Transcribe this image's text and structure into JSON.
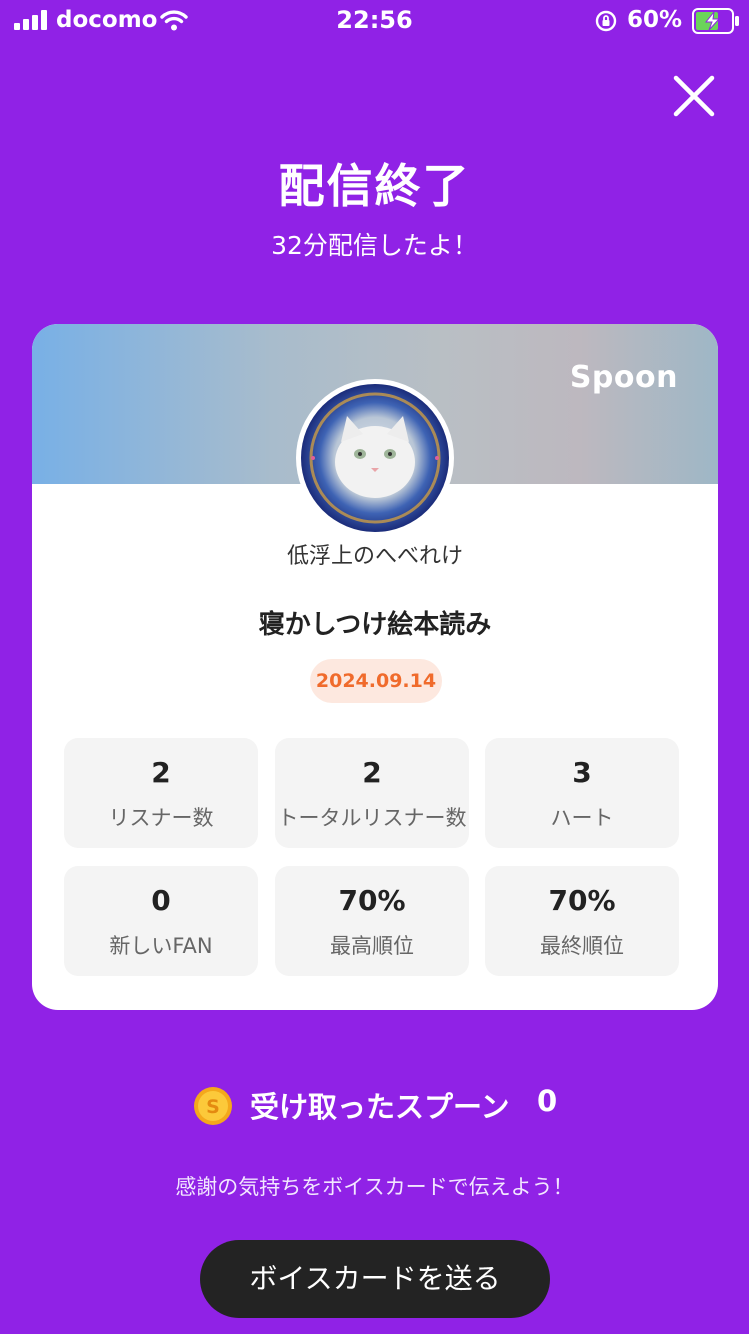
{
  "status_bar": {
    "carrier": "docomo",
    "time": "22:56",
    "battery_percent": "60%",
    "icons": [
      "signal-icon",
      "wifi-icon",
      "orientation-lock-icon",
      "battery-charging-icon"
    ]
  },
  "header": {
    "close_icon": "close-icon",
    "title": "配信終了",
    "subtitle": "32分配信したよ！"
  },
  "card": {
    "brand": "Spoon",
    "username": "低浮上のへべれけ",
    "broadcast_title": "寝かしつけ絵本読み",
    "date": "2024.09.14",
    "stats": [
      {
        "value": "2",
        "label": "リスナー数"
      },
      {
        "value": "2",
        "label": "トータルリスナー数"
      },
      {
        "value": "3",
        "label": "ハート"
      },
      {
        "value": "0",
        "label": "新しいFAN"
      },
      {
        "value": "70%",
        "label": "最高順位"
      },
      {
        "value": "70%",
        "label": "最終順位"
      }
    ]
  },
  "spoons": {
    "label": "受け取ったスプーン",
    "count": "0",
    "icon": "spoon-coin-icon"
  },
  "thanks_message": "感謝の気持ちをボイスカードで伝えよう！",
  "send_button_label": "ボイスカードを送る",
  "colors": {
    "background": "#9022e6",
    "card": "#ffffff",
    "date_badge_bg": "#fde8df",
    "date_badge_text": "#f06b2c",
    "button": "#232323"
  }
}
